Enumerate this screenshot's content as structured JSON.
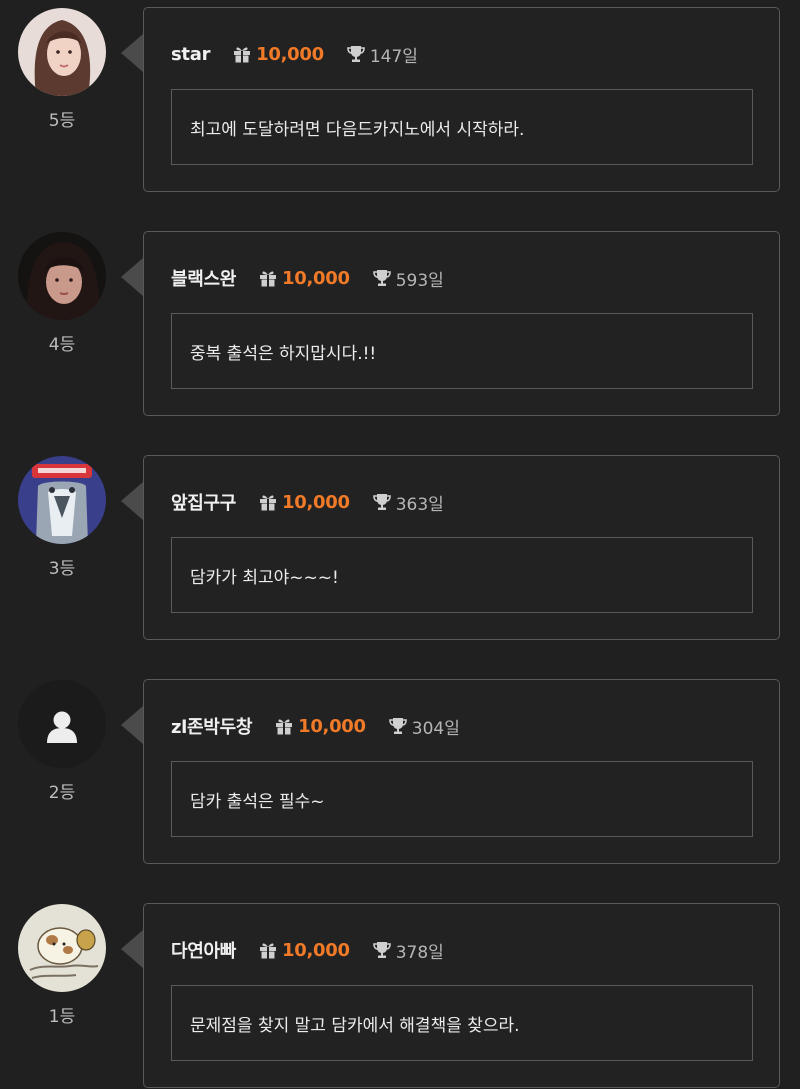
{
  "entries": [
    {
      "rank": "5등",
      "nickname": "star",
      "points": "10,000",
      "days": "147일",
      "message": "최고에 도달하려면 다음드카지노에서 시작하라.",
      "avatar": "avatar-photo-woman-light"
    },
    {
      "rank": "4등",
      "nickname": "블랙스완",
      "points": "10,000",
      "days": "593일",
      "message": "중복 출석은 하지맙시다.!!",
      "avatar": "avatar-photo-woman-dark"
    },
    {
      "rank": "3등",
      "nickname": "앞집구구",
      "points": "10,000",
      "days": "363일",
      "message": "담카가 최고야~~~!",
      "avatar": "avatar-cartoon-bird"
    },
    {
      "rank": "2등",
      "nickname": "zl존박두창",
      "points": "10,000",
      "days": "304일",
      "message": "담카 출석은 필수~",
      "avatar": "default-user-icon"
    },
    {
      "rank": "1등",
      "nickname": "다연아빠",
      "points": "10,000",
      "days": "378일",
      "message": "문제점을 찾지 말고 담카에서 해결책을 찾으라.",
      "avatar": "avatar-hamster-drawing"
    }
  ],
  "icons": {
    "points": "gift-icon",
    "attendance": "trophy-icon"
  },
  "colors": {
    "background": "#202020",
    "points": "#f07a28",
    "border": "#5a5a5a"
  }
}
